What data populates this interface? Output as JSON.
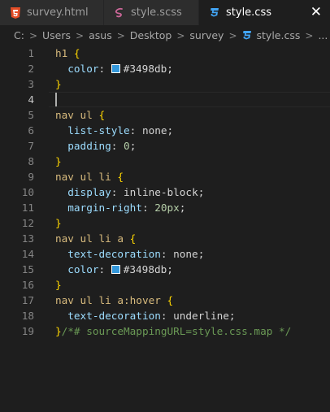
{
  "tabs": [
    {
      "label": "survey.html",
      "icon": "html5-icon",
      "active": false
    },
    {
      "label": "style.scss",
      "icon": "sass-icon",
      "active": false
    },
    {
      "label": "style.css",
      "icon": "css3-icon",
      "active": true,
      "close": "✕"
    }
  ],
  "breadcrumb": {
    "items": [
      "C:",
      "Users",
      "asus",
      "Desktop",
      "survey",
      "style.css",
      "..."
    ],
    "separator": ">"
  },
  "colors": {
    "swatch": "#3498db",
    "html_icon": "#e44d26",
    "sass_icon": "#cd6799",
    "css_icon": "#42a5f5"
  },
  "editor": {
    "current_line": 4,
    "lines": [
      {
        "n": "1",
        "tokens": [
          {
            "c": "sel",
            "t": "h1 "
          },
          {
            "c": "brace",
            "t": "{"
          }
        ]
      },
      {
        "n": "2",
        "tokens": [
          {
            "c": "plain",
            "t": "  "
          },
          {
            "c": "prop",
            "t": "color"
          },
          {
            "c": "plain",
            "t": ": "
          },
          {
            "c": "swatch",
            "t": ""
          },
          {
            "c": "plain",
            "t": "#3498db;"
          }
        ]
      },
      {
        "n": "3",
        "tokens": [
          {
            "c": "brace",
            "t": "}"
          }
        ]
      },
      {
        "n": "4",
        "tokens": []
      },
      {
        "n": "5",
        "tokens": [
          {
            "c": "sel",
            "t": "nav ul "
          },
          {
            "c": "brace",
            "t": "{"
          }
        ]
      },
      {
        "n": "6",
        "tokens": [
          {
            "c": "plain",
            "t": "  "
          },
          {
            "c": "prop",
            "t": "list-style"
          },
          {
            "c": "plain",
            "t": ": none;"
          }
        ]
      },
      {
        "n": "7",
        "tokens": [
          {
            "c": "plain",
            "t": "  "
          },
          {
            "c": "prop",
            "t": "padding"
          },
          {
            "c": "plain",
            "t": ": "
          },
          {
            "c": "num",
            "t": "0"
          },
          {
            "c": "plain",
            "t": ";"
          }
        ]
      },
      {
        "n": "8",
        "tokens": [
          {
            "c": "brace",
            "t": "}"
          }
        ]
      },
      {
        "n": "9",
        "tokens": [
          {
            "c": "sel",
            "t": "nav ul li "
          },
          {
            "c": "brace",
            "t": "{"
          }
        ]
      },
      {
        "n": "10",
        "tokens": [
          {
            "c": "plain",
            "t": "  "
          },
          {
            "c": "prop",
            "t": "display"
          },
          {
            "c": "plain",
            "t": ": inline-block;"
          }
        ]
      },
      {
        "n": "11",
        "tokens": [
          {
            "c": "plain",
            "t": "  "
          },
          {
            "c": "prop",
            "t": "margin-right"
          },
          {
            "c": "plain",
            "t": ": "
          },
          {
            "c": "num",
            "t": "20px"
          },
          {
            "c": "plain",
            "t": ";"
          }
        ]
      },
      {
        "n": "12",
        "tokens": [
          {
            "c": "brace",
            "t": "}"
          }
        ]
      },
      {
        "n": "13",
        "tokens": [
          {
            "c": "sel",
            "t": "nav ul li a "
          },
          {
            "c": "brace",
            "t": "{"
          }
        ]
      },
      {
        "n": "14",
        "tokens": [
          {
            "c": "plain",
            "t": "  "
          },
          {
            "c": "prop",
            "t": "text-decoration"
          },
          {
            "c": "plain",
            "t": ": none;"
          }
        ]
      },
      {
        "n": "15",
        "tokens": [
          {
            "c": "plain",
            "t": "  "
          },
          {
            "c": "prop",
            "t": "color"
          },
          {
            "c": "plain",
            "t": ": "
          },
          {
            "c": "swatch",
            "t": ""
          },
          {
            "c": "plain",
            "t": "#3498db;"
          }
        ]
      },
      {
        "n": "16",
        "tokens": [
          {
            "c": "brace",
            "t": "}"
          }
        ]
      },
      {
        "n": "17",
        "tokens": [
          {
            "c": "sel",
            "t": "nav ul li a:hover "
          },
          {
            "c": "brace",
            "t": "{"
          }
        ]
      },
      {
        "n": "18",
        "tokens": [
          {
            "c": "plain",
            "t": "  "
          },
          {
            "c": "prop",
            "t": "text-decoration"
          },
          {
            "c": "plain",
            "t": ": underline;"
          }
        ]
      },
      {
        "n": "19",
        "tokens": [
          {
            "c": "brace",
            "t": "}"
          },
          {
            "c": "comment",
            "t": "/*# sourceMappingURL=style.css.map */"
          }
        ]
      }
    ]
  }
}
